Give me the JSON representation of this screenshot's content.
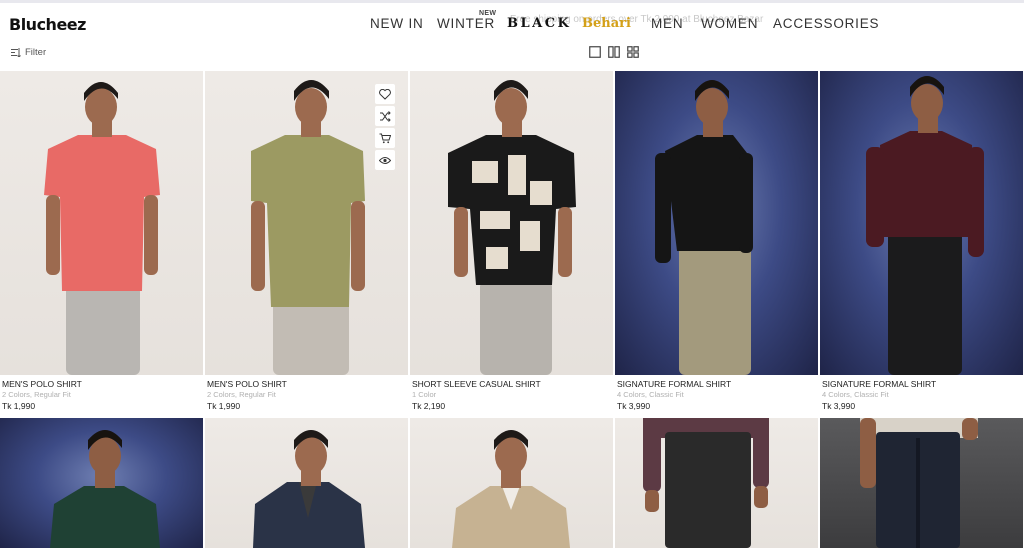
{
  "header": {
    "logo": "Blucheez",
    "ghost_text": "Free shipping on orders over Tk 2,000 at Blucheez Bazar",
    "nav": [
      {
        "label": "NEW IN"
      },
      {
        "label": "WINTER",
        "badge": "NEW"
      },
      {
        "label": "BLACK"
      },
      {
        "label": "Behari"
      },
      {
        "label": "MEN"
      },
      {
        "label": "WOMEN"
      },
      {
        "label": "ACCESSORIES"
      }
    ]
  },
  "toolbar": {
    "filter_label": "Filter",
    "views": [
      "single-column-view-icon",
      "two-column-view-icon",
      "grid-view-icon"
    ]
  },
  "quick_actions": [
    "heart-icon",
    "shuffle-icon",
    "cart-icon",
    "eye-icon"
  ],
  "products": [
    {
      "name": "MEN'S POLO SHIRT",
      "meta": "2 Colors, Regular Fit",
      "price": "Tk 1,990",
      "shirt_color": "#e86a66",
      "pants_color": "#b9b6b2",
      "bg": "light"
    },
    {
      "name": "MEN'S POLO SHIRT",
      "meta": "2 Colors, Regular Fit",
      "price": "Tk 1,990",
      "shirt_color": "#9c9a62",
      "pants_color": "#c2bcb4",
      "bg": "light"
    },
    {
      "name": "SHORT SLEEVE CASUAL SHIRT",
      "meta": "1 Color",
      "price": "Tk 2,190",
      "shirt_color": "#1a1a1a",
      "pants_color": "#b7b3ad",
      "bg": "light"
    },
    {
      "name": "SIGNATURE FORMAL SHIRT",
      "meta": "4 Colors, Classic Fit",
      "price": "Tk 3,990",
      "shirt_color": "#151515",
      "pants_color": "#a39a7d",
      "bg": "blue"
    },
    {
      "name": "SIGNATURE FORMAL SHIRT",
      "meta": "4 Colors, Classic Fit",
      "price": "Tk 3,990",
      "shirt_color": "#4b1a22",
      "pants_color": "#1b1b1c",
      "bg": "blue"
    }
  ],
  "row2": [
    {
      "shirt_color": "#1f4134",
      "bg": "blue"
    },
    {
      "shirt_color": "#2a3347",
      "bg": "light"
    },
    {
      "shirt_color": "#c6b292",
      "bg": "light"
    },
    {
      "shirt_color": "#5c3a44",
      "pants_color": "#2a2a2a",
      "bg": "light"
    },
    {
      "shirt_color": "#d8d2c8",
      "pants_color": "#1f2533",
      "bg": "dark"
    }
  ]
}
